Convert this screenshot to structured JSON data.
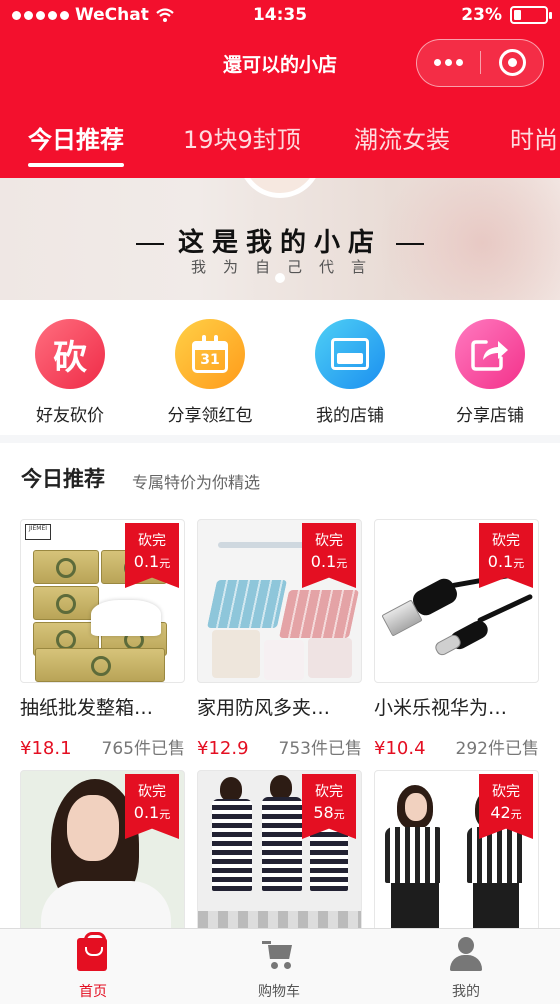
{
  "status_bar": {
    "carrier": "WeChat",
    "time": "14:35",
    "battery_percent": "23%",
    "battery_level": 0.23
  },
  "nav": {
    "title": "還可以的小店"
  },
  "tabs": [
    {
      "label": "今日推荐",
      "active": true
    },
    {
      "label": "19块9封顶"
    },
    {
      "label": "潮流女装"
    },
    {
      "label": "时尚"
    }
  ],
  "banner": {
    "title": "这是我的小店",
    "subtitle": "我为自己代言"
  },
  "quick_entries": [
    {
      "label": "好友砍价",
      "icon": "bargain-icon",
      "glyph": "砍",
      "color_from": "#ff6e7f",
      "color_to": "#ef2b47"
    },
    {
      "label": "分享领红包",
      "icon": "calendar-icon",
      "glyph": "31",
      "color_from": "#ffd047",
      "color_to": "#ff9b1a"
    },
    {
      "label": "我的店铺",
      "icon": "store-icon",
      "color_from": "#4fd0f5",
      "color_to": "#1b8ff0"
    },
    {
      "label": "分享店铺",
      "icon": "share-icon",
      "color_from": "#ff7ac0",
      "color_to": "#f3318a"
    }
  ],
  "section": {
    "title": "今日推荐",
    "subtitle": "专属特价为你精选"
  },
  "products": [
    {
      "name": "抽纸批发整箱…",
      "price": "¥18.1",
      "sold": "765件已售",
      "tag_top": "砍完",
      "tag_price": "0.1",
      "tag_unit": "元",
      "brand": "JIEMEI"
    },
    {
      "name": "家用防风多夹…",
      "price": "¥12.9",
      "sold": "753件已售",
      "tag_top": "砍完",
      "tag_price": "0.1",
      "tag_unit": "元"
    },
    {
      "name": "小米乐视华为…",
      "price": "¥10.4",
      "sold": "292件已售",
      "tag_top": "砍完",
      "tag_price": "0.1",
      "tag_unit": "元"
    },
    {
      "tag_top": "砍完",
      "tag_price": "0.1",
      "tag_unit": "元"
    },
    {
      "tag_top": "砍完",
      "tag_price": "58",
      "tag_unit": "元"
    },
    {
      "tag_top": "砍完",
      "tag_price": "42",
      "tag_unit": "元"
    }
  ],
  "tabbar": [
    {
      "label": "首页",
      "icon": "shopping-bag-icon",
      "active": true
    },
    {
      "label": "购物车",
      "icon": "cart-icon"
    },
    {
      "label": "我的",
      "icon": "user-icon"
    }
  ],
  "colors": {
    "brand_red": "#f3102d",
    "price_red": "#e40f22"
  }
}
